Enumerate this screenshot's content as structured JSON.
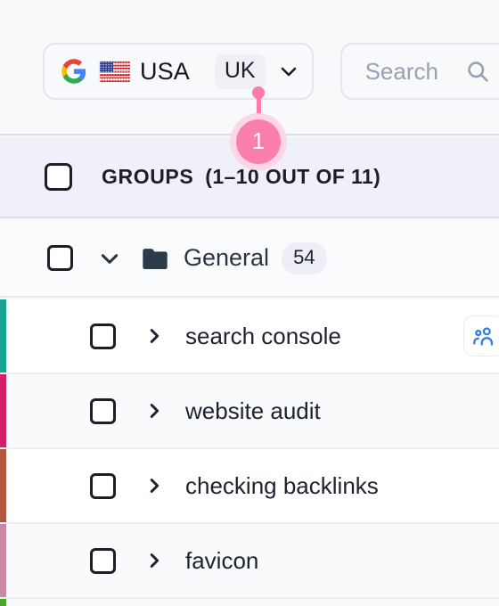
{
  "toolbar": {
    "engine_selector": {
      "logo_icon": "google-logo-icon",
      "flag_icon": "usa-flag-icon",
      "country": "USA",
      "alt_country": "UK",
      "chevron_icon": "chevron-down-icon"
    },
    "search": {
      "value": "",
      "placeholder": "Search",
      "icon": "search-icon"
    }
  },
  "annotation": {
    "step_number": "1",
    "color": "#fb7fae",
    "halo_color": "#fdd7e6",
    "target": "alt-country-chip"
  },
  "groups_header": {
    "checkbox_checked": false,
    "title": "GROUPS",
    "count_label": "(1–10 OUT OF 11)",
    "background": "#f0f0fa"
  },
  "folder": {
    "checkbox_checked": false,
    "expand_icon": "chevron-down-icon",
    "folder_icon": "folder-icon",
    "name": "General",
    "count": "54"
  },
  "keywords": [
    {
      "label": "search console",
      "checkbox_checked": false,
      "expand_icon": "chevron-right-icon",
      "bar_color": "#1aa391",
      "row_background": "#ffffff",
      "tag_icon": "people-group-icon",
      "tag_icon_color": "#2f7ce0"
    },
    {
      "label": "website audit",
      "checkbox_checked": false,
      "expand_icon": "chevron-right-icon",
      "bar_color": "#d41f6b",
      "row_background": "#f9fafb",
      "tag_icon": null,
      "tag_icon_color": null
    },
    {
      "label": "checking backlinks",
      "checkbox_checked": false,
      "expand_icon": "chevron-right-icon",
      "bar_color": "#b0573f",
      "row_background": "#ffffff",
      "tag_icon": null,
      "tag_icon_color": null
    },
    {
      "label": "favicon",
      "checkbox_checked": false,
      "expand_icon": "chevron-right-icon",
      "bar_color": "#c98aa8",
      "row_background": "#f9fafb",
      "tag_icon": null,
      "tag_icon_color": null
    }
  ],
  "next_row_partial": {
    "bar_color": "#4fa62a"
  }
}
